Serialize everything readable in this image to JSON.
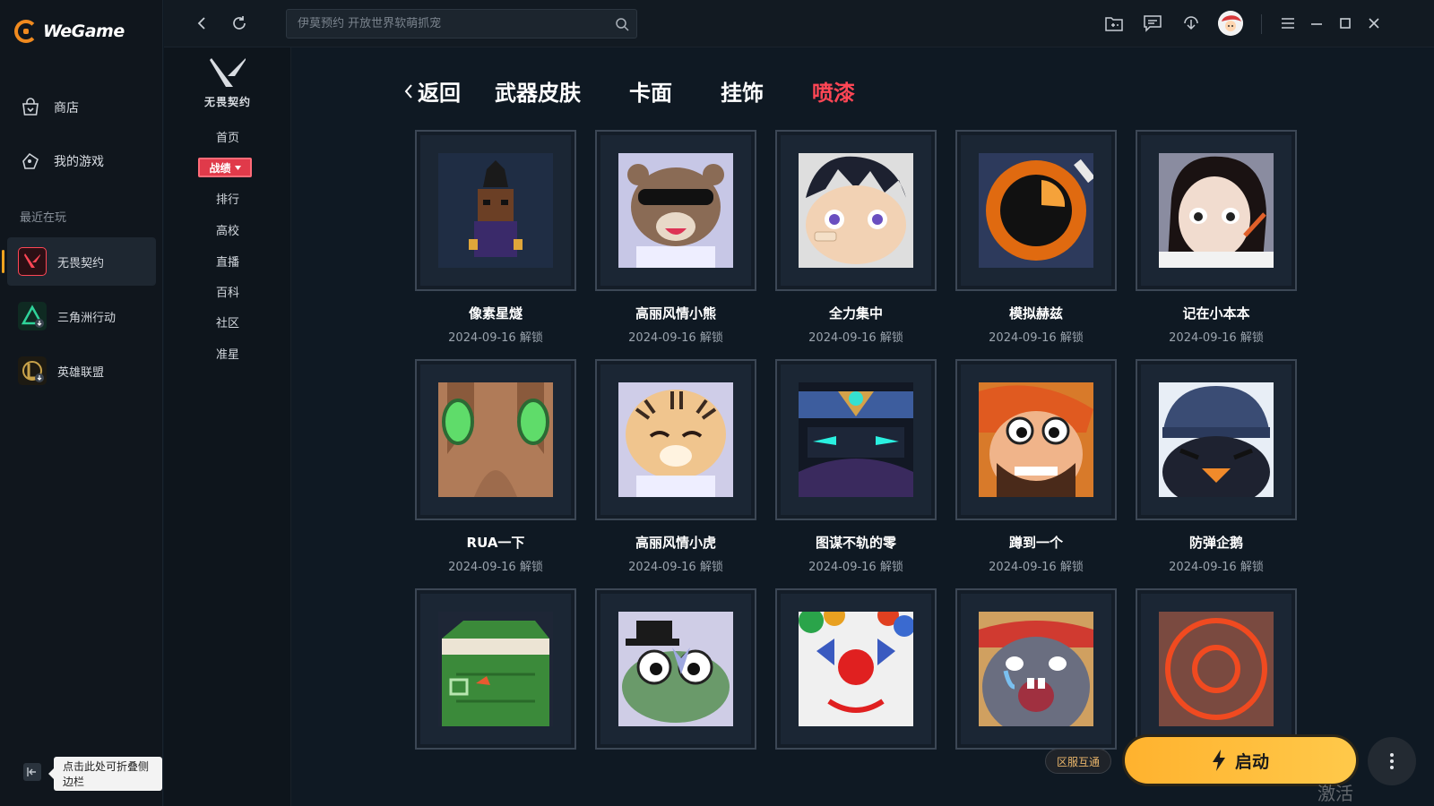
{
  "app": {
    "name": "WeGame"
  },
  "sidebar": {
    "nav": [
      {
        "label": "商店",
        "icon": "store-bag-icon"
      },
      {
        "label": "我的游戏",
        "icon": "games-icon"
      }
    ],
    "recent_title": "最近在玩",
    "games": [
      {
        "label": "无畏契约",
        "icon": "valorant-icon",
        "active": true
      },
      {
        "label": "三角洲行动",
        "icon": "delta-force-icon",
        "active": false
      },
      {
        "label": "英雄联盟",
        "icon": "league-icon",
        "active": false
      }
    ],
    "collapse_tooltip": "点击此处可折叠侧边栏"
  },
  "topbar": {
    "search_placeholder": "伊莫预约 开放世界软萌抓宠"
  },
  "game_nav": {
    "logo_text": "无畏契约",
    "items": [
      "首页",
      "排行",
      "高校",
      "直播",
      "百科",
      "社区",
      "准星"
    ],
    "badge": "战绩"
  },
  "tabs": {
    "back_label": "返回",
    "items": [
      "武器皮肤",
      "卡面",
      "挂饰",
      "喷漆"
    ],
    "active": "喷漆"
  },
  "sprays": [
    {
      "name": "像素星燧",
      "date": "2024-09-16 解锁"
    },
    {
      "name": "高丽风情小熊",
      "date": "2024-09-16 解锁"
    },
    {
      "name": "全力集中",
      "date": "2024-09-16 解锁"
    },
    {
      "name": "模拟赫兹",
      "date": "2024-09-16 解锁"
    },
    {
      "name": "记在小本本",
      "date": "2024-09-16 解锁"
    },
    {
      "name": "RUA一下",
      "date": "2024-09-16 解锁"
    },
    {
      "name": "高丽风情小虎",
      "date": "2024-09-16 解锁"
    },
    {
      "name": "图谋不轨的零",
      "date": "2024-09-16 解锁"
    },
    {
      "name": "蹲到一个",
      "date": "2024-09-16 解锁"
    },
    {
      "name": "防弹企鹅",
      "date": "2024-09-16 解锁"
    },
    {
      "name": "",
      "date": ""
    },
    {
      "name": "",
      "date": ""
    },
    {
      "name": "",
      "date": ""
    },
    {
      "name": "",
      "date": ""
    },
    {
      "name": "",
      "date": ""
    }
  ],
  "bottom": {
    "server_badge": "区服互通",
    "launch_label": "启动",
    "watermark": "激活 Windows"
  },
  "colors": {
    "accent": "#ff4655",
    "launch": "#ffb22e",
    "bg": "#0f1923"
  }
}
